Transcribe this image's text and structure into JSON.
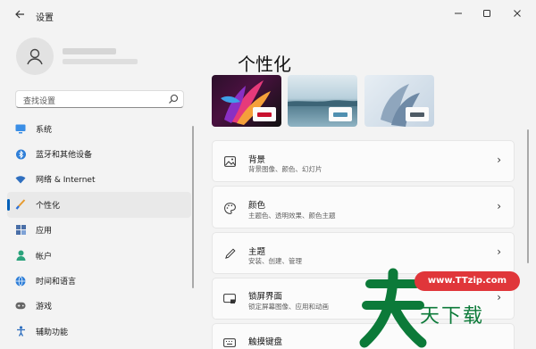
{
  "window": {
    "title": "设置"
  },
  "sidebar": {
    "search_placeholder": "查找设置",
    "items": [
      {
        "label": "系统",
        "icon": "monitor-icon"
      },
      {
        "label": "蓝牙和其他设备",
        "icon": "bluetooth-icon"
      },
      {
        "label": "网络 & Internet",
        "icon": "wifi-icon"
      },
      {
        "label": "个性化",
        "icon": "brush-icon",
        "selected": true
      },
      {
        "label": "应用",
        "icon": "apps-icon"
      },
      {
        "label": "帐户",
        "icon": "account-icon"
      },
      {
        "label": "时间和语言",
        "icon": "globe-clock-icon"
      },
      {
        "label": "游戏",
        "icon": "gamepad-icon"
      },
      {
        "label": "辅助功能",
        "icon": "accessibility-icon"
      }
    ]
  },
  "main": {
    "title": "个性化",
    "cards": [
      {
        "title": "背景",
        "subtitle": "背景图像、颜色、幻灯片",
        "icon": "picture-icon"
      },
      {
        "title": "颜色",
        "subtitle": "主题色、透明效果、颜色主题",
        "icon": "palette-icon"
      },
      {
        "title": "主题",
        "subtitle": "安装、创建、管理",
        "icon": "pen-icon"
      },
      {
        "title": "锁屏界面",
        "subtitle": "锁定屏幕图像、应用和动画",
        "icon": "lock-screen-icon"
      },
      {
        "title": "触摸键盘",
        "subtitle": "",
        "icon": "keyboard-icon"
      }
    ]
  },
  "watermark": {
    "url": "www.TTzip.com",
    "text": "天下载"
  },
  "colors": {
    "accent": "#005fb8",
    "watermark_green": "#0c7a39",
    "watermark_red": "#e0363a"
  }
}
